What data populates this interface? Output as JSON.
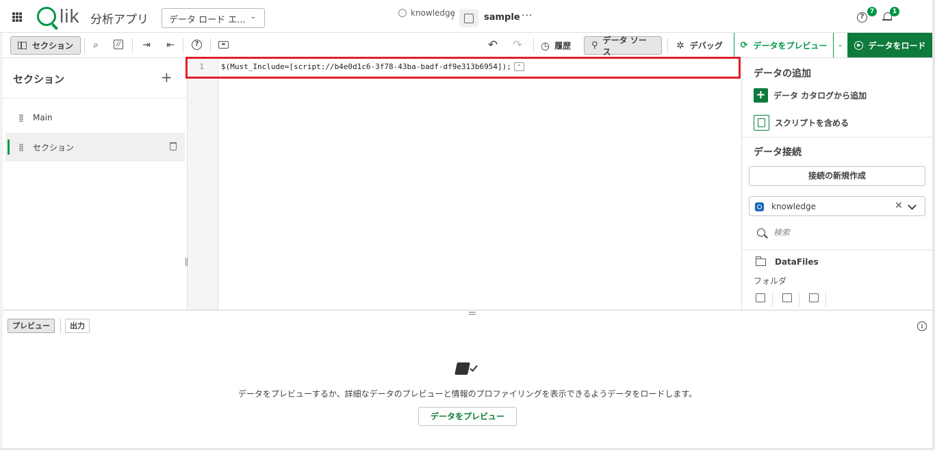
{
  "header": {
    "logo_text": "Qlik",
    "app_label": "分析アプリ",
    "mode_select": "データ ロード エ...",
    "space_name": "knowledge",
    "separator": "/",
    "app_name": "sample",
    "more": "···",
    "help_badge": "7",
    "notification_badge": "1"
  },
  "toolbar": {
    "sections_label": "セクション",
    "history_label": "履歴",
    "datasource_label": "データ ソース",
    "debug_label": "デバッグ",
    "preview_label": "データをプレビュー",
    "load_label": "データをロード"
  },
  "sections": {
    "title": "セクション",
    "items": [
      {
        "label": "Main",
        "selected": false
      },
      {
        "label": "セクション",
        "selected": true
      }
    ]
  },
  "editor": {
    "lines": [
      {
        "number": "1",
        "code": "$(Must_Include=[script://b4e0d1c6-3f78-43ba-badf-df9e313b6954]);"
      }
    ],
    "fold_chip": "^"
  },
  "data_panel": {
    "add_heading": "データの追加",
    "add_from_catalog": "データ カタログから追加",
    "include_script": "スクリプトを含める",
    "connections_heading": "データ接続",
    "new_connection": "接続の新規作成",
    "selected_connection": "knowledge",
    "search_placeholder": "検索",
    "folder_name": "DataFiles",
    "folder_type": "フォルダ"
  },
  "bottom_panel": {
    "tabs": [
      "プレビュー",
      "出力"
    ],
    "empty_message": "データをプレビューするか、詳細なデータのプレビューと情報のプロファイリングを表示できるようデータをロードします。",
    "preview_button": "データをプレビュー"
  },
  "colors": {
    "brand_green": "#009845",
    "dark_green": "#0e7a3b",
    "highlight_red": "#e0202a",
    "connection_blue": "#1466b8"
  },
  "icons": [
    "grid-menu-icon",
    "space-icon",
    "app-icon",
    "help-icon",
    "bell-icon",
    "section-panel-icon",
    "search-icon",
    "comment-icon",
    "indent-icon",
    "outdent-icon",
    "help-circle-icon",
    "keyboard-icon",
    "undo-icon",
    "redo-icon",
    "history-icon",
    "data-source-icon",
    "bug-icon",
    "preview-icon",
    "play-icon",
    "plus-icon",
    "script-icon",
    "connection-icon",
    "folder-icon",
    "info-icon"
  ]
}
